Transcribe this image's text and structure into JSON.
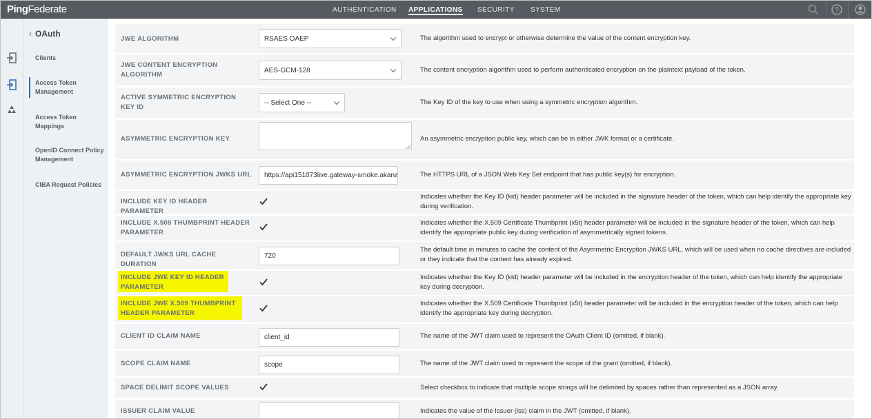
{
  "app": {
    "logo_bold": "Ping",
    "logo_rest": "Federate"
  },
  "nav": [
    {
      "label": "AUTHENTICATION",
      "active": false
    },
    {
      "label": "APPLICATIONS",
      "active": true
    },
    {
      "label": "SECURITY",
      "active": false
    },
    {
      "label": "SYSTEM",
      "active": false
    }
  ],
  "top_icons": [
    "search-icon",
    "help-icon",
    "user-icon"
  ],
  "rail_icons": [
    "sign-in-icon",
    "token-icon",
    "recycle-icon"
  ],
  "subnav": {
    "back_label": "OAuth",
    "items": [
      {
        "label": "Clients",
        "selected": false
      },
      {
        "label": "Access Token Management",
        "selected": true
      },
      {
        "label": "Access Token Mappings",
        "selected": false
      },
      {
        "label": "OpenID Connect Policy Management",
        "selected": false
      },
      {
        "label": "CIBA Request Policies",
        "selected": false
      }
    ]
  },
  "accent_color": "#2b6fb3",
  "highlight_color": "#f5f500",
  "rows": [
    {
      "label": "JWE ALGORITHM",
      "control": "select",
      "value": "RSAES OAEP",
      "description": "The algorithm used to encrypt or otherwise determine the value of the content encryption key."
    },
    {
      "label": "JWE CONTENT ENCRYPTION ALGORITHM",
      "control": "select",
      "value": "AES-GCM-128",
      "description": "The content encryption algorithm used to perform authenticated encryption on the plaintext payload of the token."
    },
    {
      "label": "ACTIVE SYMMETRIC ENCRYPTION KEY ID",
      "control": "select",
      "value": "-- Select One --",
      "description": "The Key ID of the key to use when using a symmetric encryption algorithm."
    },
    {
      "label": "ASYMMETRIC ENCRYPTION KEY",
      "control": "textarea",
      "value": "",
      "description": "An asymmetric encryption public key, which can be in either JWK format or a certificate."
    },
    {
      "label": "ASYMMETRIC ENCRYPTION JWKS URL",
      "control": "text",
      "value": "https://api151073live.gateway-smoke.akana.",
      "description": "The HTTPS URL of a JSON Web Key Set endpoint that has public key(s) for encryption."
    },
    {
      "label": "INCLUDE KEY ID HEADER PARAMETER",
      "control": "checkbox",
      "value": "checked",
      "description": "Indicates whether the Key ID (kid) header parameter will be included in the signature header of the token, which can help identify the appropriate key during verification."
    },
    {
      "label": "INCLUDE X.509 THUMBPRINT HEADER PARAMETER",
      "control": "checkbox",
      "value": "checked",
      "description": "Indicates whether the X.509 Certificate Thumbprint (x5t) header parameter will be included in the signature header of the token, which can help identify the appropriate public key during verification of asymmetrically signed tokens."
    },
    {
      "label": "DEFAULT JWKS URL CACHE DURATION",
      "control": "text",
      "value": "720",
      "description": "The default time in minutes to cache the content of the Asymmetric Encryption JWKS URL, which will be used when no cache directives are included or they indicate that the content has already expired."
    },
    {
      "label": "INCLUDE JWE KEY ID HEADER PARAMETER",
      "control": "checkbox",
      "value": "checked",
      "highlighted": true,
      "description": "Indicates whether the Key ID (kid) header parameter will be included in the encryption header of the token, which can help identify the appropriate key during decryption."
    },
    {
      "label": "INCLUDE JWE X.509 THUMBPRINT HEADER PARAMETER",
      "control": "checkbox",
      "value": "checked",
      "highlighted": true,
      "description": "Indicates whether the X.509 Certificate Thumbprint (x5t) header parameter will be included in the encryption header of the token, which can help identify the appropriate key during decryption."
    },
    {
      "label": "CLIENT ID CLAIM NAME",
      "control": "text",
      "value": "client_id",
      "description": "The name of the JWT claim used to represent the OAuth Client ID (omitted, if blank)."
    },
    {
      "label": "SCOPE CLAIM NAME",
      "control": "text",
      "value": "scope",
      "description": "The name of the JWT claim used to represent the scope of the grant (omitted, if blank)."
    },
    {
      "label": "SPACE DELIMIT SCOPE VALUES",
      "control": "checkbox",
      "value": "checked",
      "description": "Select checkbox to indicate that multiple scope strings will be delimited by spaces rather than represented as a JSON array."
    },
    {
      "label": "ISSUER CLAIM VALUE",
      "control": "text",
      "value": "",
      "description": "Indicates the value of the Issuer (iss) claim in the JWT (omitted, if blank)."
    }
  ]
}
